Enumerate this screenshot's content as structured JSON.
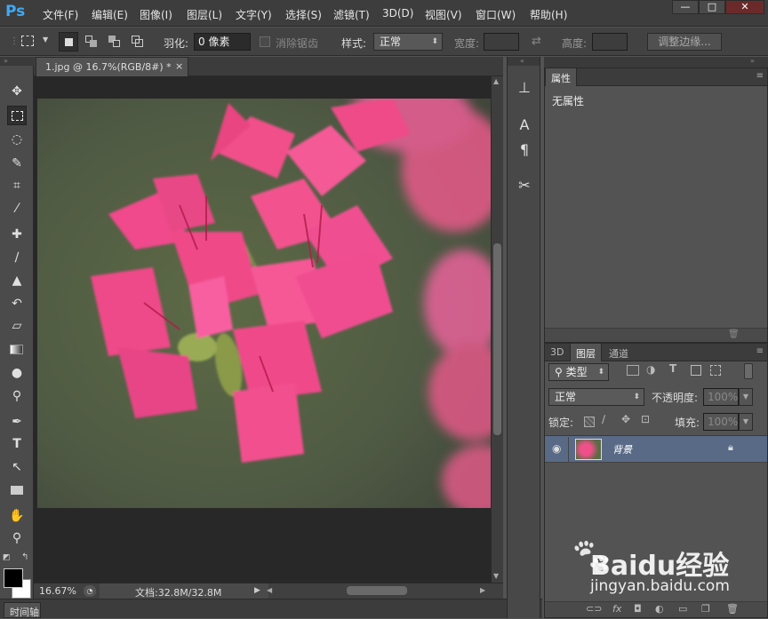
{
  "app": {
    "logo": "Ps"
  },
  "menu": [
    "文件(F)",
    "编辑(E)",
    "图像(I)",
    "图层(L)",
    "文字(Y)",
    "选择(S)",
    "滤镜(T)",
    "3D(D)",
    "视图(V)",
    "窗口(W)",
    "帮助(H)"
  ],
  "window_controls": {
    "minimize": "—",
    "maximize": "□",
    "close": "✕"
  },
  "options": {
    "feather_label": "羽化:",
    "feather_value": "0 像素",
    "antialias_label": "消除锯齿",
    "style_label": "样式:",
    "style_value": "正常",
    "width_label": "宽度:",
    "height_label": "高度:",
    "refine_edge": "调整边缘..."
  },
  "document": {
    "tab_title": "1.jpg @ 16.7%(RGB/8#) *",
    "tab_close": "×",
    "zoom": "16.67%",
    "doc_size": "文档:32.8M/32.8M"
  },
  "timeline": {
    "label": "时间轴"
  },
  "properties": {
    "tab": "属性",
    "content": "无属性"
  },
  "layers": {
    "tabs": [
      "3D",
      "图层",
      "通道"
    ],
    "kind_filter": "类型",
    "blend_mode": "正常",
    "opacity_label": "不透明度:",
    "opacity_value": "100%",
    "lock_label": "锁定:",
    "fill_label": "填充:",
    "fill_value": "100%",
    "items": [
      {
        "name": "背景",
        "locked": true,
        "visible": true
      }
    ]
  },
  "icons": {
    "move": "move-icon",
    "marquee": "rect-marquee-icon",
    "lasso": "lasso-icon",
    "quickselect": "quick-select-icon",
    "crop": "crop-icon",
    "eyedropper": "eyedropper-icon",
    "healing": "healing-brush-icon",
    "brush": "brush-icon",
    "stamp": "clone-stamp-icon",
    "history": "history-brush-icon",
    "eraser": "eraser-icon",
    "gradient": "gradient-icon",
    "blur": "blur-icon",
    "dodge": "dodge-icon",
    "pen": "pen-icon",
    "type": "type-icon",
    "path": "path-select-icon",
    "shape": "rectangle-shape-icon",
    "hand": "hand-icon",
    "zoom": "zoom-icon"
  },
  "colors": {
    "accent": "#3fa9f5",
    "selected_layer": "#596a86",
    "foreground": "#000000",
    "background": "#ffffff"
  },
  "watermark": {
    "brand": "Baidu经验",
    "url": "jingyan.baidu.com"
  }
}
